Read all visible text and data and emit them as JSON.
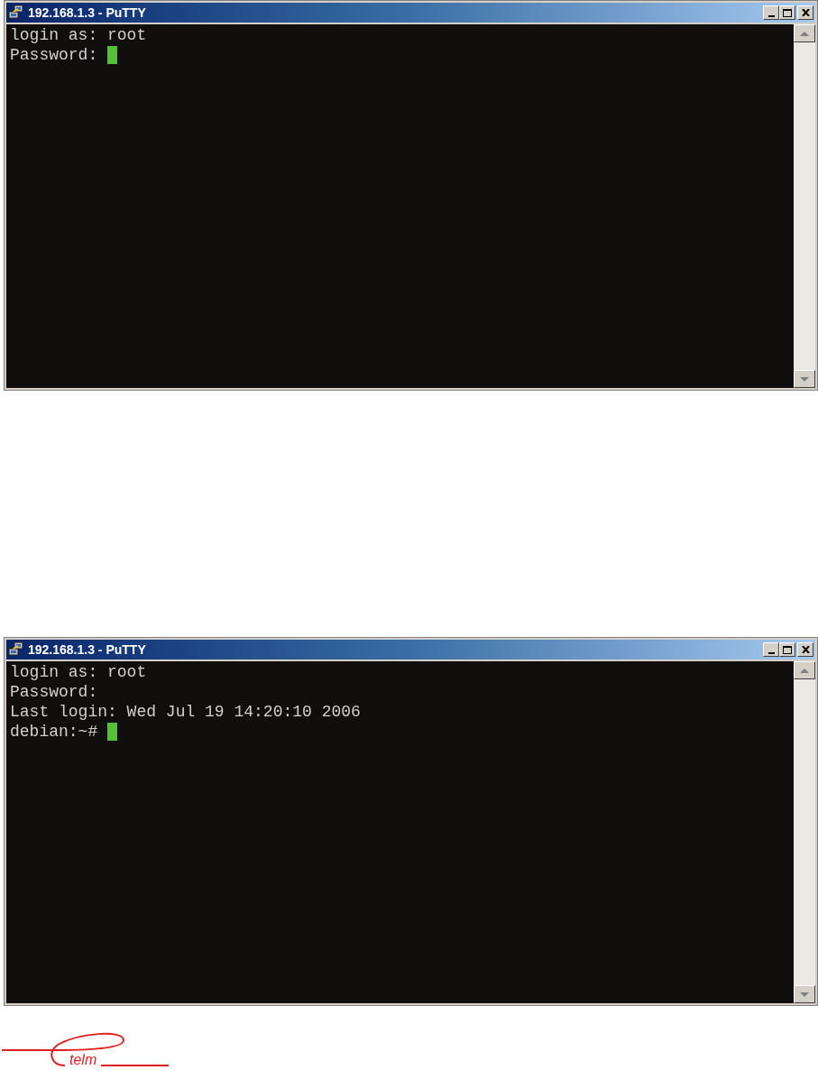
{
  "windows": [
    {
      "title": "192.168.1.3 - PuTTY",
      "lines": [
        {
          "text": "login as: root",
          "cursor": false
        },
        {
          "text": "Password: ",
          "cursor": true
        }
      ]
    },
    {
      "title": "192.168.1.3 - PuTTY",
      "lines": [
        {
          "text": "login as: root",
          "cursor": false
        },
        {
          "text": "Password:",
          "cursor": false
        },
        {
          "text": "Last login: Wed Jul 19 14:20:10 2006",
          "cursor": false
        },
        {
          "text": "debian:~# ",
          "cursor": true
        }
      ]
    }
  ],
  "logo": {
    "text": "telm"
  }
}
